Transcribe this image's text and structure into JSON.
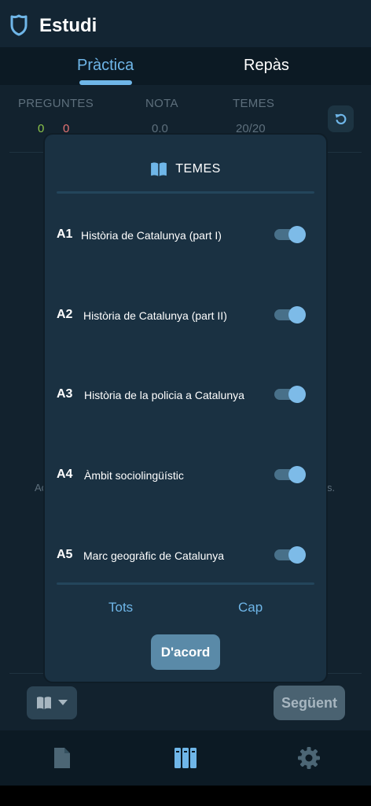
{
  "app": {
    "title": "Estudi"
  },
  "tabs": [
    {
      "label": "Pràctica",
      "active": true
    },
    {
      "label": "Repàs",
      "active": false
    }
  ],
  "stats": {
    "preguntes_label": "PREGUNTES",
    "correct": "0",
    "wrong": "0",
    "nota_label": "NOTA",
    "nota_value": "0.0",
    "temes_label": "TEMES",
    "temes_value": "20/20"
  },
  "background_hint": {
    "left_fragment": "Ac",
    "right_fragment": "s."
  },
  "modal": {
    "title": "TEMES",
    "topics": [
      {
        "code": "A1",
        "label": "Història de Catalunya (part I)",
        "enabled": true
      },
      {
        "code": "A2",
        "label": "Història de Catalunya (part II)",
        "enabled": true
      },
      {
        "code": "A3",
        "label": "Història de la policia a Catalunya",
        "enabled": true
      },
      {
        "code": "A4",
        "label": "Àmbit sociolingüístic",
        "enabled": true
      },
      {
        "code": "A5",
        "label": "Marc geogràfic de Catalunya",
        "enabled": true
      }
    ],
    "select_all_label": "Tots",
    "select_none_label": "Cap",
    "confirm_label": "D'acord"
  },
  "actions": {
    "next_label": "Següent"
  },
  "colors": {
    "accent": "#6fb6e8",
    "correct": "#8bc34a",
    "wrong": "#e57373",
    "background": "#12222e",
    "modal_bg": "#1a3142"
  },
  "icons": {
    "logo": "shield-icon",
    "reset": "refresh-icon",
    "book": "book-open-icon",
    "dropdown": "caret-down-icon",
    "nav_doc": "document-icon",
    "nav_library": "library-icon",
    "nav_settings": "gear-icon"
  }
}
